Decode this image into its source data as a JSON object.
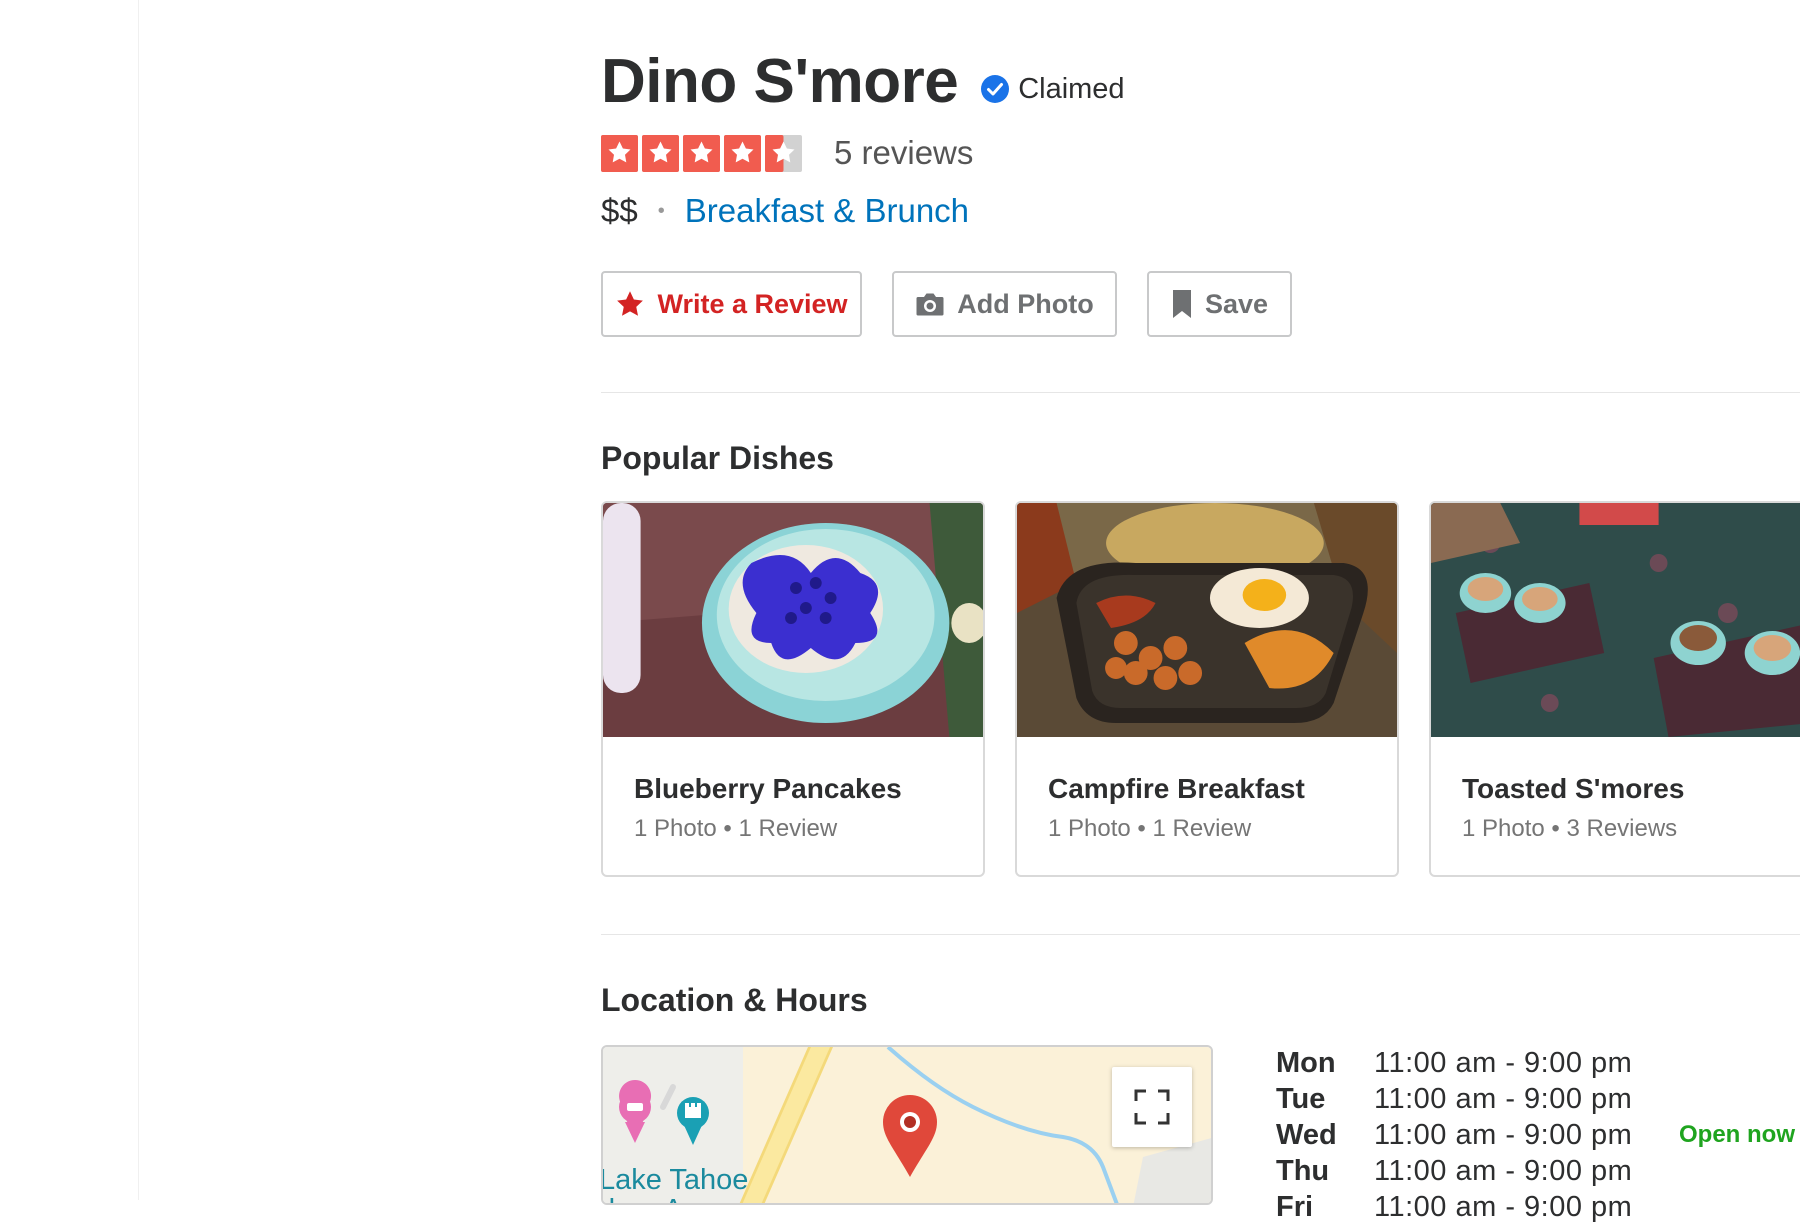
{
  "business": {
    "name": "Dino S'more",
    "claimed_label": "Claimed",
    "rating": 4.5,
    "rating_max": 5,
    "reviews_label": "5 reviews",
    "price": "$$",
    "category": "Breakfast & Brunch"
  },
  "actions": {
    "write_review": "Write a Review",
    "add_photo": "Add Photo",
    "save": "Save"
  },
  "popular_dishes": {
    "heading": "Popular Dishes",
    "items": [
      {
        "name": "Blueberry Pancakes",
        "meta": "1 Photo • 1 Review"
      },
      {
        "name": "Campfire Breakfast",
        "meta": "1 Photo • 1 Review"
      },
      {
        "name": "Toasted S'mores",
        "meta": "1 Photo • 3 Reviews"
      }
    ]
  },
  "location": {
    "heading": "Location & Hours",
    "map_label": "Lake Tahoe\ndoor Arena",
    "hours": [
      {
        "day": "Mon",
        "time": "11:00 am - 9:00 pm",
        "status": ""
      },
      {
        "day": "Tue",
        "time": "11:00 am - 9:00 pm",
        "status": ""
      },
      {
        "day": "Wed",
        "time": "11:00 am - 9:00 pm",
        "status": "Open now"
      },
      {
        "day": "Thu",
        "time": "11:00 am - 9:00 pm",
        "status": ""
      },
      {
        "day": "Fri",
        "time": "11:00 am - 9:00 pm",
        "status": ""
      }
    ]
  },
  "colors": {
    "star": "#f15c4f",
    "link": "#0073bb",
    "review_red": "#d32323",
    "open_green": "#1fa41f",
    "verified_blue": "#1a73e8"
  }
}
